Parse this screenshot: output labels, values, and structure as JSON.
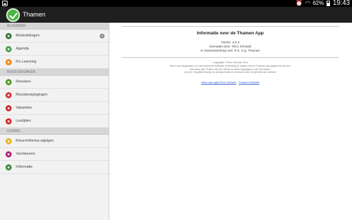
{
  "status_bar": {
    "battery": "62%",
    "time": "19:43",
    "icons": [
      "picture-icon",
      "alarm-icon",
      "wifi-icon",
      "battery-icon"
    ]
  },
  "action_bar": {
    "title": "Thamen",
    "app_icon": "checkmark-icon"
  },
  "drawer": {
    "sections": [
      {
        "header": "ALGEMEEN",
        "items": [
          {
            "label": "Mededelingen",
            "icon": "megaphone-icon",
            "color": "#3d7a3d",
            "badge": "0"
          },
          {
            "label": "Agenda",
            "icon": "agenda-icon",
            "color": "#4aa34a"
          },
          {
            "label": "It's Learning",
            "icon": "learning-icon",
            "color": "#ef8a17"
          }
        ]
      },
      {
        "header": "ROOSTERZAKEN",
        "items": [
          {
            "label": "Roosters",
            "icon": "roster-icon",
            "color": "#5b9b2f"
          },
          {
            "label": "Roosterwijzigingen",
            "icon": "roster-changes-icon",
            "color": "#d13b3b"
          },
          {
            "label": "Vakanties",
            "icon": "holiday-icon",
            "color": "#c9313a"
          },
          {
            "label": "Lestijden",
            "icon": "clock-icon",
            "color": "#d6302f"
          }
        ]
      },
      {
        "header": "OVERIG",
        "items": [
          {
            "label": "Kleurenthema wijzigen",
            "icon": "palette-icon",
            "color": "#e8b42a"
          },
          {
            "label": "Voorkeuren",
            "icon": "settings-icon",
            "color": "#b0287a"
          },
          {
            "label": "Informatie",
            "icon": "info-icon",
            "color": "#3f8f3f"
          }
        ]
      }
    ]
  },
  "about": {
    "title": "Informatie over de Thamen App",
    "version": "Versie: 4.0.3",
    "made_by": "Gemaakt door: Rico Schwab",
    "collab": "In Samenwerking met: R.k. S.g. Thamen",
    "copyright_lines": [
      "Copyrights © Rico Schwab 2014",
      "Het is niet toegestaan om met verkeerde software verbinding te maken met de Thamen App gegevens servers.",
      "Met dank aan: Ruben van der Weide en Mark Spaargarer voor het testen.",
      "Les Op. Mogelijk bevingt uw privacy kosten in verband voor het gebruik van internet."
    ],
    "link_more": "Meer van apps Rico Schwab",
    "link_separator": "-",
    "link_website": "Thamen Website"
  }
}
